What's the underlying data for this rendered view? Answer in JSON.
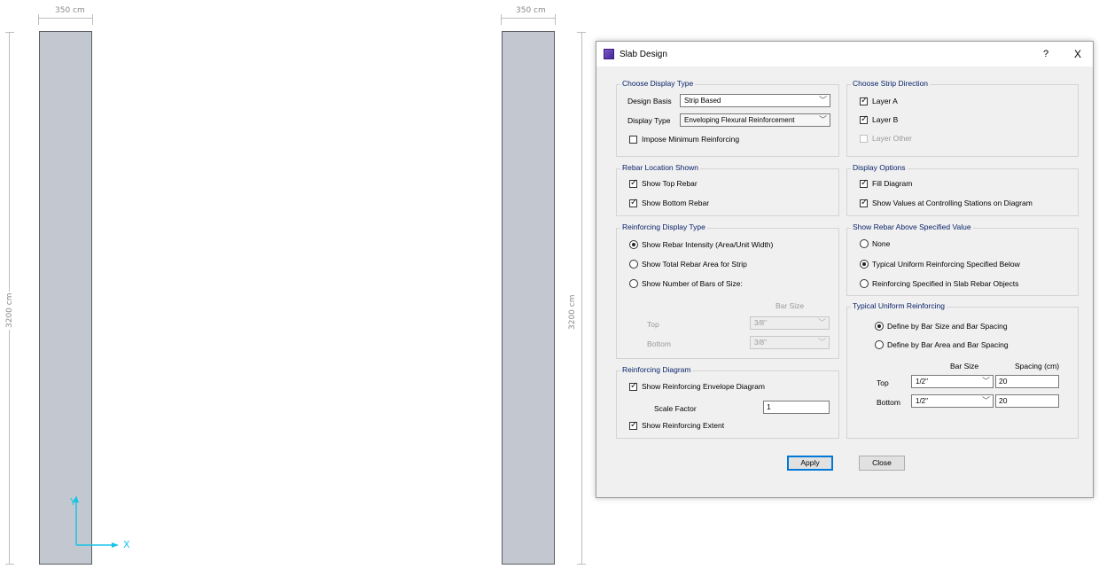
{
  "canvas": {
    "left_view": {
      "width_dim": "350 cm",
      "height_dim": "3200 cm"
    },
    "right_view": {
      "width_dim": "350 cm",
      "height_dim": "3200 cm"
    },
    "axes": {
      "y_label": "Y",
      "x_label": "X",
      "color": "#19c3e6"
    }
  },
  "dialog": {
    "title": "Slab Design",
    "help_label": "?",
    "close_glyph": "X",
    "display_type_group": {
      "legend": "Choose Display Type",
      "design_basis_label": "Design Basis",
      "design_basis_value": "Strip Based",
      "display_type_label": "Display Type",
      "display_type_value": "Enveloping Flexural Reinforcement",
      "impose_min_label": "Impose Minimum Reinforcing"
    },
    "strip_direction_group": {
      "legend": "Choose Strip Direction",
      "layer_a": "Layer A",
      "layer_b": "Layer B",
      "layer_other": "Layer Other"
    },
    "rebar_location_group": {
      "legend": "Rebar Location Shown",
      "top": "Show Top Rebar",
      "bottom": "Show Bottom Rebar"
    },
    "display_options_group": {
      "legend": "Display Options",
      "fill": "Fill Diagram",
      "values": "Show Values at Controlling Stations on Diagram"
    },
    "reinf_display_group": {
      "legend": "Reinforcing Display Type",
      "intensity": "Show Rebar Intensity (Area/Unit Width)",
      "total_area": "Show Total Rebar Area for Strip",
      "num_bars": "Show Number of Bars of Size:",
      "bar_size_header": "Bar Size",
      "top_label": "Top",
      "top_value": "3/8\"",
      "bottom_label": "Bottom",
      "bottom_value": "3/8\""
    },
    "show_above_group": {
      "legend": "Show Rebar Above Specified Value",
      "none": "None",
      "typical": "Typical Uniform Reinforcing Specified Below",
      "slab_objects": "Reinforcing Specified in Slab Rebar Objects"
    },
    "typical_uniform_group": {
      "legend": "Typical Uniform Reinforcing",
      "by_size": "Define by Bar Size and Bar Spacing",
      "by_area": "Define by Bar Area and Bar Spacing",
      "bar_size_header": "Bar Size",
      "spacing_header": "Spacing  (cm)",
      "top_label": "Top",
      "top_size": "1/2\"",
      "top_spacing": "20",
      "bottom_label": "Bottom",
      "bottom_size": "1/2\"",
      "bottom_spacing": "20"
    },
    "reinf_diagram_group": {
      "legend": "Reinforcing Diagram",
      "envelope": "Show Reinforcing Envelope Diagram",
      "scale_label": "Scale Factor",
      "scale_value": "1",
      "extent": "Show Reinforcing Extent"
    },
    "apply_label": "Apply",
    "close_label": "Close"
  }
}
